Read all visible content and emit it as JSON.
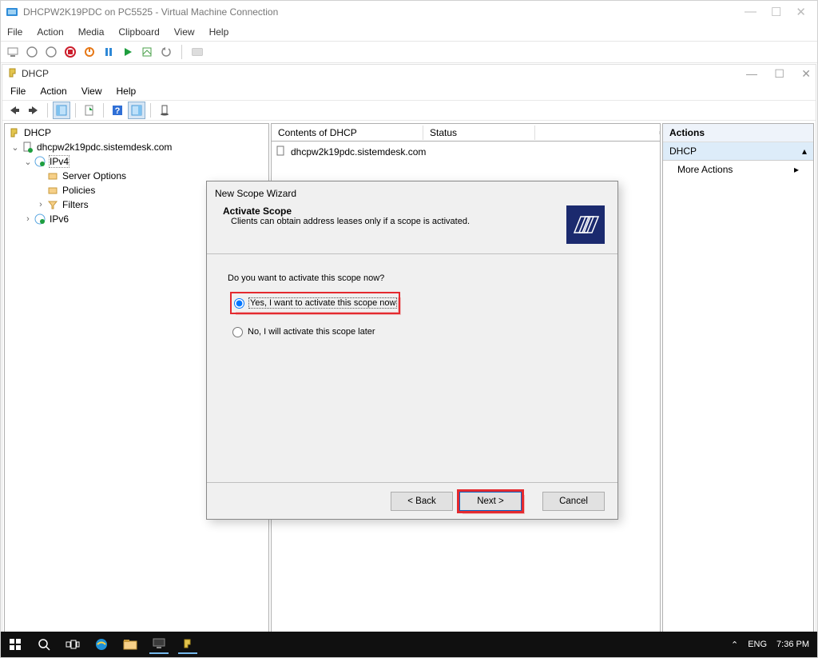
{
  "vm": {
    "title": "DHCPW2K19PDC on PC5525 - Virtual Machine Connection",
    "menu": [
      "File",
      "Action",
      "Media",
      "Clipboard",
      "View",
      "Help"
    ],
    "window_controls": {
      "minimize": "—",
      "maximize": "☐",
      "close": "✕"
    }
  },
  "dhcp": {
    "title": "DHCP",
    "menu": [
      "File",
      "Action",
      "View",
      "Help"
    ],
    "window_controls": {
      "minimize": "—",
      "maximize": "☐",
      "close": "✕"
    }
  },
  "tree": {
    "root": "DHCP",
    "server": "dhcpw2k19pdc.sistemdesk.com",
    "ipv4": "IPv4",
    "ipv4_children": [
      "Server Options",
      "Policies",
      "Filters"
    ],
    "ipv6": "IPv6"
  },
  "mid": {
    "col1": "Contents of DHCP",
    "col2": "Status",
    "row1": "dhcpw2k19pdc.sistemdesk.com"
  },
  "actions": {
    "header": "Actions",
    "item": "DHCP",
    "more": "More Actions"
  },
  "wizard": {
    "title": "New Scope Wizard",
    "heading": "Activate Scope",
    "sub": "Clients can obtain address leases only if a scope is activated.",
    "question": "Do you want to activate this scope now?",
    "opt1": "Yes, I want to activate this scope now",
    "opt2": "No, I will activate this scope later",
    "back": "< Back",
    "next": "Next >",
    "cancel": "Cancel"
  },
  "taskbar": {
    "lang": "ENG",
    "time": "7:36 PM"
  }
}
